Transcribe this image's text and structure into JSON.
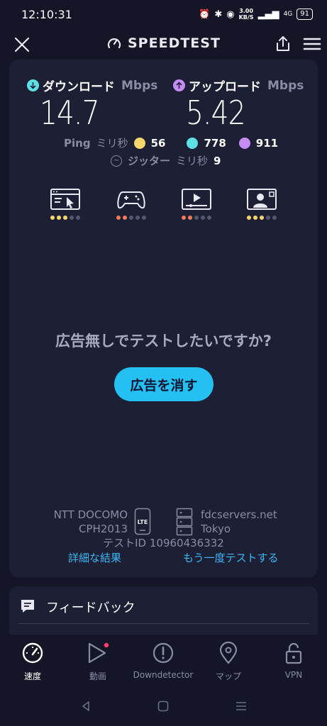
{
  "status": {
    "time": "12:10:31",
    "speed": "3.00",
    "speed_unit": "KB/S",
    "network": "4G",
    "battery": "91"
  },
  "header": {
    "logo_text": "SPEEDTEST"
  },
  "download": {
    "label": "ダウンロード",
    "unit": "Mbps",
    "value": "14.7"
  },
  "upload": {
    "label": "アップロード",
    "unit": "Mbps",
    "value": "5.42"
  },
  "ping": {
    "label": "Ping",
    "unit": "ミリ秒",
    "idle": "56",
    "download": "778",
    "upload": "911"
  },
  "jitter": {
    "label": "ジッター",
    "unit": "ミリ秒",
    "value": "9"
  },
  "quality": [
    {
      "icon": "web-browsing-icon",
      "dots": [
        "#f5d76e",
        "#f5d76e",
        "#f5d76e",
        "#555770",
        "#555770"
      ]
    },
    {
      "icon": "gaming-icon",
      "dots": [
        "#f27a5b",
        "#f27a5b",
        "#555770",
        "#555770",
        "#555770"
      ]
    },
    {
      "icon": "video-streaming-icon",
      "dots": [
        "#f27a5b",
        "#f27a5b",
        "#555770",
        "#555770",
        "#555770"
      ]
    },
    {
      "icon": "video-chat-icon",
      "dots": [
        "#f5d76e",
        "#f5d76e",
        "#f5d76e",
        "#555770",
        "#555770"
      ]
    }
  ],
  "ad": {
    "question": "広告無しでテストしたいですか?",
    "button": "広告を消す"
  },
  "provider": {
    "name": "NTT DOCOMO",
    "device": "CPH2013",
    "connection": "LTE"
  },
  "server": {
    "host": "fdcservers.net",
    "location": "Tokyo"
  },
  "test_id": "テストID 10960436332",
  "links": {
    "details": "詳細な結果",
    "retest": "もう一度テストする"
  },
  "feedback": {
    "title": "フィードバック"
  },
  "nav": [
    {
      "label": "速度",
      "icon": "speedometer-icon",
      "active": true
    },
    {
      "label": "動画",
      "icon": "play-icon",
      "active": false
    },
    {
      "label": "Downdetector",
      "icon": "alert-icon",
      "active": false
    },
    {
      "label": "マップ",
      "icon": "map-pin-icon",
      "active": false
    },
    {
      "label": "VPN",
      "icon": "lock-icon",
      "active": false
    }
  ],
  "colors": {
    "accent": "#23c0f1",
    "download": "#5ce0e6",
    "upload": "#c58cf5",
    "ping_idle": "#f5d76e"
  }
}
